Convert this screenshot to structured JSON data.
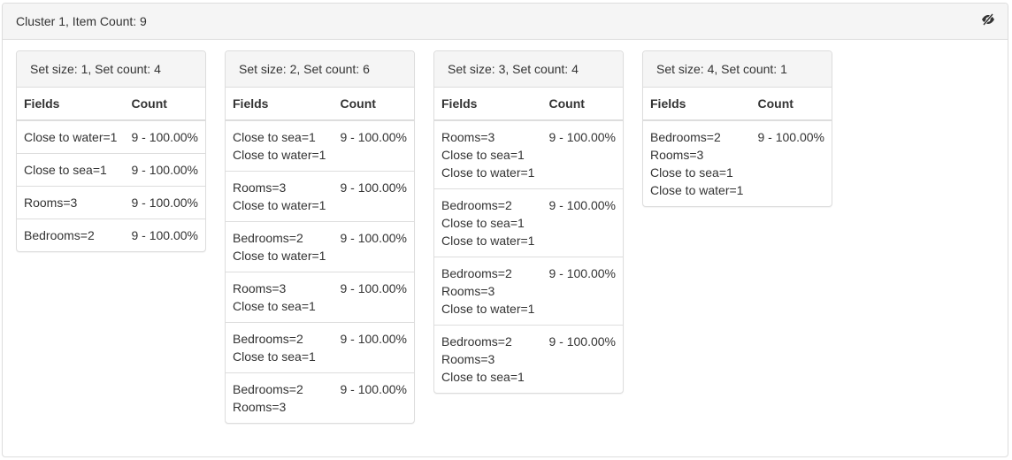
{
  "cluster": {
    "title": "Cluster 1, Item Count: 9",
    "toggle_icon": "eye-slash-icon"
  },
  "table_headers": {
    "fields": "Fields",
    "count": "Count"
  },
  "sets": [
    {
      "title": "Set size: 1, Set count: 4",
      "rows": [
        {
          "fields": [
            "Close to water=1"
          ],
          "count": "9 - 100.00%"
        },
        {
          "fields": [
            "Close to sea=1"
          ],
          "count": "9 - 100.00%"
        },
        {
          "fields": [
            "Rooms=3"
          ],
          "count": "9 - 100.00%"
        },
        {
          "fields": [
            "Bedrooms=2"
          ],
          "count": "9 - 100.00%"
        }
      ]
    },
    {
      "title": "Set size: 2, Set count: 6",
      "rows": [
        {
          "fields": [
            "Close to sea=1",
            "Close to water=1"
          ],
          "count": "9 - 100.00%"
        },
        {
          "fields": [
            "Rooms=3",
            "Close to water=1"
          ],
          "count": "9 - 100.00%"
        },
        {
          "fields": [
            "Bedrooms=2",
            "Close to water=1"
          ],
          "count": "9 - 100.00%"
        },
        {
          "fields": [
            "Rooms=3",
            "Close to sea=1"
          ],
          "count": "9 - 100.00%"
        },
        {
          "fields": [
            "Bedrooms=2",
            "Close to sea=1"
          ],
          "count": "9 - 100.00%"
        },
        {
          "fields": [
            "Bedrooms=2",
            "Rooms=3"
          ],
          "count": "9 - 100.00%"
        }
      ]
    },
    {
      "title": "Set size: 3, Set count: 4",
      "rows": [
        {
          "fields": [
            "Rooms=3",
            "Close to sea=1",
            "Close to water=1"
          ],
          "count": "9 - 100.00%"
        },
        {
          "fields": [
            "Bedrooms=2",
            "Close to sea=1",
            "Close to water=1"
          ],
          "count": "9 - 100.00%"
        },
        {
          "fields": [
            "Bedrooms=2",
            "Rooms=3",
            "Close to water=1"
          ],
          "count": "9 - 100.00%"
        },
        {
          "fields": [
            "Bedrooms=2",
            "Rooms=3",
            "Close to sea=1"
          ],
          "count": "9 - 100.00%"
        }
      ]
    },
    {
      "title": "Set size: 4, Set count: 1",
      "rows": [
        {
          "fields": [
            "Bedrooms=2",
            "Rooms=3",
            "Close to sea=1",
            "Close to water=1"
          ],
          "count": "9 - 100.00%"
        }
      ]
    }
  ]
}
